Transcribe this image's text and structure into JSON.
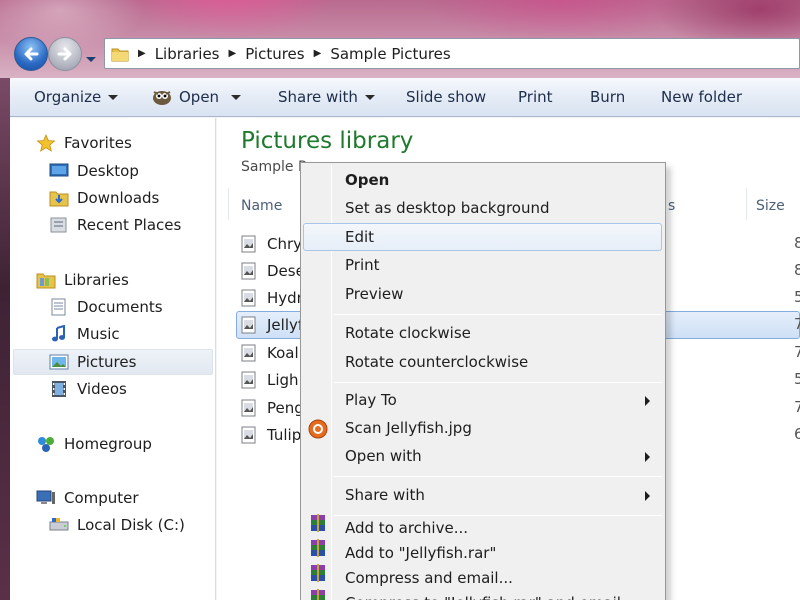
{
  "breadcrumb": [
    "Libraries",
    "Pictures",
    "Sample Pictures"
  ],
  "toolbar": {
    "organize": "Organize",
    "open": "Open",
    "share_with": "Share with",
    "slide_show": "Slide show",
    "print": "Print",
    "burn": "Burn",
    "new_folder": "New folder"
  },
  "sidebar": {
    "favorites": "Favorites",
    "desktop": "Desktop",
    "downloads": "Downloads",
    "recent_places": "Recent Places",
    "libraries": "Libraries",
    "documents": "Documents",
    "music": "Music",
    "pictures": "Pictures",
    "videos": "Videos",
    "homegroup": "Homegroup",
    "computer": "Computer",
    "local_disk": "Local Disk (C:)"
  },
  "library": {
    "title": "Pictures library",
    "subtitle": "Sample P"
  },
  "columns": {
    "name": "Name",
    "tags_partial": "s",
    "size": "Size"
  },
  "files": [
    {
      "name": "Chry",
      "size": "8"
    },
    {
      "name": "Dese",
      "size": "8"
    },
    {
      "name": "Hydr",
      "size": "5"
    },
    {
      "name": "Jellyf",
      "size": "7"
    },
    {
      "name": "Koal",
      "size": "7"
    },
    {
      "name": "Ligh",
      "size": "5"
    },
    {
      "name": "Peng",
      "size": "7"
    },
    {
      "name": "Tulip",
      "size": "6"
    }
  ],
  "context_menu": {
    "open": "Open",
    "set_desktop_bg": "Set as desktop background",
    "edit": "Edit",
    "print": "Print",
    "preview": "Preview",
    "rotate_cw": "Rotate clockwise",
    "rotate_ccw": "Rotate counterclockwise",
    "play_to": "Play To",
    "scan": "Scan Jellyfish.jpg",
    "open_with": "Open with",
    "share_with": "Share with",
    "add_archive": "Add to archive...",
    "add_rar": "Add to \"Jellyfish.rar\"",
    "compress_email": "Compress and email...",
    "compress_rar_email": "Compress to \"Jellyfish.rar\" and email"
  },
  "colors": {
    "title_green": "#1e7a2c",
    "selection_border": "#84acdd",
    "menu_bg": "#f0f0f0"
  }
}
